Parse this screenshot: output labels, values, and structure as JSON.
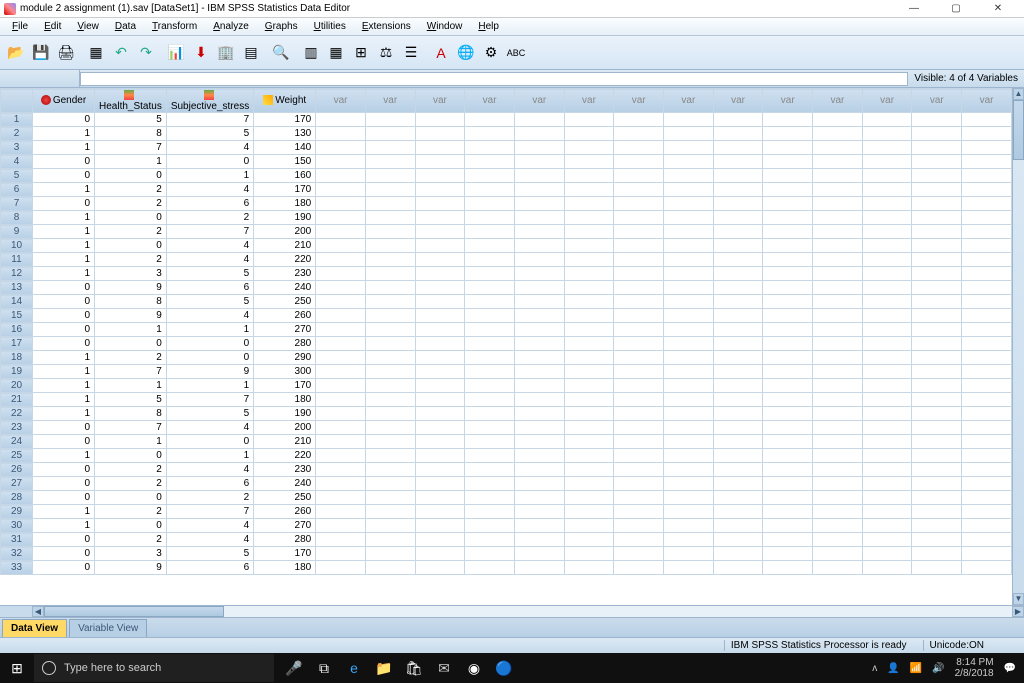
{
  "window": {
    "title": "module 2 assignment (1).sav [DataSet1] - IBM SPSS Statistics Data Editor",
    "min": "—",
    "max": "▢",
    "close": "✕"
  },
  "menu": [
    "File",
    "Edit",
    "View",
    "Data",
    "Transform",
    "Analyze",
    "Graphs",
    "Utilities",
    "Extensions",
    "Window",
    "Help"
  ],
  "info": {
    "visible": "Visible: 4 of 4 Variables"
  },
  "columns": [
    {
      "label": "Gender",
      "icon": "nom"
    },
    {
      "label": "Health_Status",
      "icon": "ord"
    },
    {
      "label": "Subjective_stress",
      "icon": "ord"
    },
    {
      "label": "Weight",
      "icon": "scale"
    }
  ],
  "empty_col": "var",
  "chart_data": {
    "type": "table",
    "columns": [
      "Gender",
      "Health_Status",
      "Subjective_stress",
      "Weight"
    ],
    "rows": [
      [
        0,
        5,
        7,
        170
      ],
      [
        1,
        8,
        5,
        130
      ],
      [
        1,
        7,
        4,
        140
      ],
      [
        0,
        1,
        0,
        150
      ],
      [
        0,
        0,
        1,
        160
      ],
      [
        1,
        2,
        4,
        170
      ],
      [
        0,
        2,
        6,
        180
      ],
      [
        1,
        0,
        2,
        190
      ],
      [
        1,
        2,
        7,
        200
      ],
      [
        1,
        0,
        4,
        210
      ],
      [
        1,
        2,
        4,
        220
      ],
      [
        1,
        3,
        5,
        230
      ],
      [
        0,
        9,
        6,
        240
      ],
      [
        0,
        8,
        5,
        250
      ],
      [
        0,
        9,
        4,
        260
      ],
      [
        0,
        1,
        1,
        270
      ],
      [
        0,
        0,
        0,
        280
      ],
      [
        1,
        2,
        0,
        290
      ],
      [
        1,
        7,
        9,
        300
      ],
      [
        1,
        1,
        1,
        170
      ],
      [
        1,
        5,
        7,
        180
      ],
      [
        1,
        8,
        5,
        190
      ],
      [
        0,
        7,
        4,
        200
      ],
      [
        0,
        1,
        0,
        210
      ],
      [
        1,
        0,
        1,
        220
      ],
      [
        0,
        2,
        4,
        230
      ],
      [
        0,
        2,
        6,
        240
      ],
      [
        0,
        0,
        2,
        250
      ],
      [
        1,
        2,
        7,
        260
      ],
      [
        1,
        0,
        4,
        270
      ],
      [
        0,
        2,
        4,
        280
      ],
      [
        0,
        3,
        5,
        170
      ],
      [
        0,
        9,
        6,
        180
      ]
    ]
  },
  "tabs": {
    "data": "Data View",
    "variable": "Variable View"
  },
  "status": {
    "proc": "IBM SPSS Statistics Processor is ready",
    "unicode": "Unicode:ON"
  },
  "taskbar": {
    "search_placeholder": "Type here to search",
    "time": "8:14 PM",
    "date": "2/8/2018"
  }
}
